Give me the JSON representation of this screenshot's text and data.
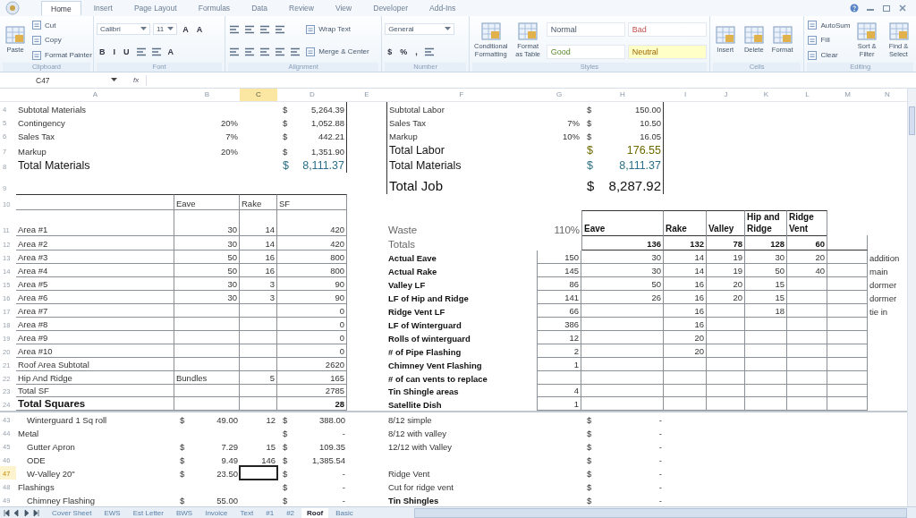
{
  "ribbon": {
    "tabs": [
      {
        "label": "Home",
        "selected": true
      },
      {
        "label": "Insert",
        "selected": false
      },
      {
        "label": "Page Layout",
        "selected": false
      },
      {
        "label": "Formulas",
        "selected": false
      },
      {
        "label": "Data",
        "selected": false
      },
      {
        "label": "Review",
        "selected": false
      },
      {
        "label": "View",
        "selected": false
      },
      {
        "label": "Developer",
        "selected": false
      },
      {
        "label": "Add-Ins",
        "selected": false
      }
    ],
    "groups": [
      {
        "label": "Clipboard",
        "columns": [
          [
            [
              {
                "kind": "large",
                "label": "Paste"
              }
            ]
          ],
          [
            [
              {
                "kind": "small",
                "label": "Cut"
              }
            ],
            [
              {
                "kind": "small",
                "label": "Copy"
              }
            ],
            [
              {
                "kind": "small",
                "label": "Format Painter"
              }
            ]
          ]
        ]
      },
      {
        "label": "Font",
        "columns": [
          [
            [
              {
                "kind": "field",
                "label": "Calibri"
              },
              {
                "kind": "field",
                "label": "11"
              },
              {
                "kind": "glyph",
                "label": "A"
              },
              {
                "kind": "glyph",
                "label": "A"
              }
            ],
            [
              {
                "kind": "glyph",
                "label": "B"
              },
              {
                "kind": "glyph",
                "label": "I"
              },
              {
                "kind": "glyph",
                "label": "U"
              },
              {
                "kind": "icon"
              },
              {
                "kind": "icon"
              },
              {
                "kind": "glyph",
                "label": "A"
              }
            ]
          ]
        ]
      },
      {
        "label": "Alignment",
        "columns": [
          [
            [
              {
                "kind": "icon"
              },
              {
                "kind": "icon"
              },
              {
                "kind": "icon"
              },
              {
                "kind": "icon"
              }
            ],
            [
              {
                "kind": "icon"
              },
              {
                "kind": "icon"
              },
              {
                "kind": "icon"
              },
              {
                "kind": "icon"
              },
              {
                "kind": "icon"
              }
            ]
          ],
          [
            [
              {
                "kind": "small",
                "label": "Wrap Text"
              }
            ],
            [
              {
                "kind": "small",
                "label": "Merge & Center"
              }
            ]
          ]
        ]
      },
      {
        "label": "Number",
        "columns": [
          [
            [
              {
                "kind": "field",
                "label": "General"
              }
            ],
            [
              {
                "kind": "glyph",
                "label": "$"
              },
              {
                "kind": "glyph",
                "label": "%"
              },
              {
                "kind": "glyph",
                "label": ","
              },
              {
                "kind": "icon"
              }
            ]
          ]
        ]
      },
      {
        "label": "Styles",
        "columns": [
          [
            [
              {
                "kind": "large",
                "label": "Conditional Formatting"
              }
            ]
          ],
          [
            [
              {
                "kind": "large",
                "label": "Format as Table"
              }
            ]
          ],
          [
            [
              {
                "kind": "style",
                "label": "Normal"
              },
              {
                "kind": "style",
                "label": "Bad"
              }
            ],
            [
              {
                "kind": "style",
                "label": "Good"
              },
              {
                "kind": "style",
                "label": "Neutral"
              }
            ]
          ]
        ]
      },
      {
        "label": "Cells",
        "columns": [
          [
            [
              {
                "kind": "large",
                "label": "Insert"
              }
            ]
          ],
          [
            [
              {
                "kind": "large",
                "label": "Delete"
              }
            ]
          ],
          [
            [
              {
                "kind": "large",
                "label": "Format"
              }
            ]
          ]
        ]
      },
      {
        "label": "Editing",
        "columns": [
          [
            [
              {
                "kind": "small",
                "label": "AutoSum"
              }
            ],
            [
              {
                "kind": "small",
                "label": "Fill"
              }
            ],
            [
              {
                "kind": "small",
                "label": "Clear"
              }
            ]
          ],
          [
            [
              {
                "kind": "large",
                "label": "Sort & Filter"
              }
            ]
          ],
          [
            [
              {
                "kind": "large",
                "label": "Find & Select"
              }
            ]
          ]
        ]
      }
    ]
  },
  "formula_bar": {
    "name_box": "C47",
    "function_label": "fx"
  },
  "sheet": {
    "columns": [
      {
        "label": "A",
        "selected": false
      },
      {
        "label": "B",
        "selected": false
      },
      {
        "label": "C",
        "selected": true
      },
      {
        "label": "D",
        "selected": false
      },
      {
        "label": "E",
        "selected": false
      },
      {
        "label": "F",
        "selected": false
      },
      {
        "label": "G",
        "selected": false
      },
      {
        "label": "H",
        "selected": false
      },
      {
        "label": "I",
        "selected": false
      },
      {
        "label": "J",
        "selected": false
      },
      {
        "label": "K",
        "selected": false
      },
      {
        "label": "L",
        "selected": false
      },
      {
        "label": "M",
        "selected": false
      },
      {
        "label": "N",
        "selected": false
      }
    ],
    "frozen_rows": [
      {
        "num": "4",
        "kind": "normal",
        "selected": false,
        "left_frame": true,
        "right_frame": true,
        "cells": [
          {
            "kind": "text",
            "text": "Subtotal Materials"
          },
          null,
          null,
          {
            "kind": "money",
            "cur": "$",
            "text": "5,264.39"
          },
          null,
          {
            "kind": "text",
            "text": "Subtotal Labor"
          },
          null,
          {
            "kind": "money",
            "cur": "$",
            "text": "150.00"
          },
          null,
          null,
          null,
          null,
          null,
          null
        ]
      },
      {
        "num": "5",
        "kind": "normal",
        "selected": false,
        "left_frame": true,
        "right_frame": true,
        "cells": [
          {
            "kind": "text",
            "text": "Contingency"
          },
          {
            "kind": "number",
            "text": "20%"
          },
          null,
          {
            "kind": "money",
            "cur": "$",
            "text": "1,052.88"
          },
          null,
          {
            "kind": "text",
            "text": "Sales Tax"
          },
          {
            "kind": "number",
            "text": "7%"
          },
          {
            "kind": "money",
            "cur": "$",
            "text": "10.50"
          },
          null,
          null,
          null,
          null,
          null,
          null
        ]
      },
      {
        "num": "6",
        "kind": "normal",
        "selected": false,
        "left_frame": true,
        "right_frame": true,
        "cells": [
          {
            "kind": "text",
            "text": "Sales Tax"
          },
          {
            "kind": "number",
            "text": "7%"
          },
          null,
          {
            "kind": "money",
            "cur": "$",
            "text": "442.21"
          },
          null,
          {
            "kind": "text",
            "text": "Markup"
          },
          {
            "kind": "number",
            "text": "10%"
          },
          {
            "kind": "money",
            "cur": "$",
            "text": "16.05"
          },
          null,
          null,
          null,
          null,
          null,
          null
        ]
      },
      {
        "num": "7",
        "kind": "tall",
        "selected": false,
        "left_frame": true,
        "right_frame": true,
        "cells": [
          {
            "kind": "text",
            "text": "Markup"
          },
          {
            "kind": "number",
            "text": "20%"
          },
          null,
          {
            "kind": "money",
            "cur": "$",
            "text": "1,351.90"
          },
          null,
          {
            "kind": "large",
            "text": "Total Labor"
          },
          null,
          {
            "kind": "labor",
            "cur": "$",
            "text": "176.55"
          },
          null,
          null,
          null,
          null,
          null,
          null
        ]
      },
      {
        "num": "8",
        "kind": "tall",
        "selected": false,
        "left_frame": true,
        "right_frame": true,
        "cells": [
          {
            "kind": "large",
            "text": "Total Materials"
          },
          null,
          null,
          {
            "kind": "sum",
            "cur": "$",
            "text": "8,111.37"
          },
          null,
          {
            "kind": "large",
            "text": "Total Materials"
          },
          null,
          {
            "kind": "sum",
            "cur": "$",
            "text": "8,111.37"
          },
          null,
          null,
          null,
          null,
          null,
          null
        ]
      },
      {
        "num": "9",
        "kind": "big",
        "selected": false,
        "right_frame": true,
        "cells": [
          null,
          null,
          null,
          null,
          null,
          {
            "kind": "title",
            "text": "Total Job"
          },
          null,
          {
            "kind": "grand",
            "cur": "$",
            "text": "8,287.92"
          },
          null,
          null,
          null,
          null,
          null,
          null
        ]
      },
      {
        "num": "10",
        "kind": "header",
        "selected": false,
        "left_grid": true,
        "cells": [
          null,
          {
            "kind": "text",
            "text": "Eave"
          },
          {
            "kind": "text",
            "text": "Rake"
          },
          {
            "kind": "text",
            "text": "SF"
          },
          null,
          null,
          null,
          null,
          null,
          null,
          null,
          null,
          null,
          null
        ]
      },
      {
        "num": "11",
        "kind": "double",
        "selected": false,
        "left_grid": true,
        "right_header": true,
        "cells": [
          {
            "kind": "text",
            "text": "Area #1"
          },
          {
            "kind": "number",
            "text": "30"
          },
          {
            "kind": "number",
            "text": "14"
          },
          {
            "kind": "number",
            "text": "420"
          },
          null,
          {
            "kind": "faint",
            "text": "Waste"
          },
          {
            "kind": "measure",
            "text": "110%"
          },
          {
            "kind": "heading",
            "text": "Eave"
          },
          {
            "kind": "heading",
            "text": "Rake"
          },
          {
            "kind": "heading",
            "text": "Valley"
          },
          {
            "kind": "heading",
            "text": "Hip and Ridge"
          },
          {
            "kind": "heading",
            "text": "Ridge Vent"
          },
          null,
          null
        ]
      },
      {
        "num": "12",
        "kind": "tall",
        "selected": false,
        "left_grid": true,
        "right_totals": true,
        "cells": [
          {
            "kind": "text",
            "text": "Area #2"
          },
          {
            "kind": "number",
            "text": "30"
          },
          {
            "kind": "number",
            "text": "14"
          },
          {
            "kind": "number",
            "text": "420"
          },
          null,
          {
            "kind": "faint",
            "text": "Totals"
          },
          null,
          {
            "kind": "figure",
            "text": "136"
          },
          {
            "kind": "figure",
            "text": "132"
          },
          {
            "kind": "figure",
            "text": "78"
          },
          {
            "kind": "figure",
            "text": "128"
          },
          {
            "kind": "figure",
            "text": "60"
          },
          null,
          null
        ]
      },
      {
        "num": "13",
        "kind": "normal",
        "selected": false,
        "left_grid": true,
        "right_grid": true,
        "cells": [
          {
            "kind": "text",
            "text": "Area #3"
          },
          {
            "kind": "number",
            "text": "50"
          },
          {
            "kind": "number",
            "text": "16"
          },
          {
            "kind": "number",
            "text": "800"
          },
          null,
          {
            "kind": "strong",
            "text": "Actual Eave"
          },
          {
            "kind": "number",
            "text": "150"
          },
          {
            "kind": "number",
            "text": "30"
          },
          {
            "kind": "number",
            "text": "14"
          },
          {
            "kind": "number",
            "text": "19"
          },
          {
            "kind": "number",
            "text": "30"
          },
          {
            "kind": "number",
            "text": "20"
          },
          null,
          {
            "kind": "text",
            "text": "addition"
          }
        ]
      },
      {
        "num": "14",
        "kind": "normal",
        "selected": false,
        "left_grid": true,
        "right_grid": true,
        "cells": [
          {
            "kind": "text",
            "text": "Area #4"
          },
          {
            "kind": "number",
            "text": "50"
          },
          {
            "kind": "number",
            "text": "16"
          },
          {
            "kind": "number",
            "text": "800"
          },
          null,
          {
            "kind": "strong",
            "text": "Actual Rake"
          },
          {
            "kind": "number",
            "text": "145"
          },
          {
            "kind": "number",
            "text": "30"
          },
          {
            "kind": "number",
            "text": "14"
          },
          {
            "kind": "number",
            "text": "19"
          },
          {
            "kind": "number",
            "text": "50"
          },
          {
            "kind": "number",
            "text": "40"
          },
          null,
          {
            "kind": "text",
            "text": "main"
          }
        ]
      },
      {
        "num": "15",
        "kind": "normal",
        "selected": false,
        "left_grid": true,
        "right_grid": true,
        "cells": [
          {
            "kind": "text",
            "text": "Area #5"
          },
          {
            "kind": "number",
            "text": "30"
          },
          {
            "kind": "number",
            "text": "3"
          },
          {
            "kind": "number",
            "text": "90"
          },
          null,
          {
            "kind": "strong",
            "text": "Valley LF"
          },
          {
            "kind": "number",
            "text": "86"
          },
          {
            "kind": "number",
            "text": "50"
          },
          {
            "kind": "number",
            "text": "16"
          },
          {
            "kind": "number",
            "text": "20"
          },
          {
            "kind": "number",
            "text": "15"
          },
          null,
          null,
          {
            "kind": "text",
            "text": "dormer"
          }
        ]
      },
      {
        "num": "16",
        "kind": "normal",
        "selected": false,
        "left_grid": true,
        "right_grid": true,
        "cells": [
          {
            "kind": "text",
            "text": "Area #6"
          },
          {
            "kind": "number",
            "text": "30"
          },
          {
            "kind": "number",
            "text": "3"
          },
          {
            "kind": "number",
            "text": "90"
          },
          null,
          {
            "kind": "strong",
            "text": "LF of Hip and Ridge"
          },
          {
            "kind": "number",
            "text": "141"
          },
          {
            "kind": "number",
            "text": "26"
          },
          {
            "kind": "number",
            "text": "16"
          },
          {
            "kind": "number",
            "text": "20"
          },
          {
            "kind": "number",
            "text": "15"
          },
          null,
          null,
          {
            "kind": "text",
            "text": "dormer"
          }
        ]
      },
      {
        "num": "17",
        "kind": "normal",
        "selected": false,
        "left_grid": true,
        "right_grid": true,
        "cells": [
          {
            "kind": "text",
            "text": "Area #7"
          },
          null,
          null,
          {
            "kind": "number",
            "text": "0"
          },
          null,
          {
            "kind": "strong",
            "text": "Ridge Vent LF"
          },
          {
            "kind": "number",
            "text": "66"
          },
          null,
          {
            "kind": "number",
            "text": "16"
          },
          null,
          {
            "kind": "number",
            "text": "18"
          },
          null,
          null,
          {
            "kind": "text",
            "text": "tie in"
          }
        ]
      },
      {
        "num": "18",
        "kind": "normal",
        "selected": false,
        "left_grid": true,
        "right_grid": true,
        "cells": [
          {
            "kind": "text",
            "text": "Area #8"
          },
          null,
          null,
          {
            "kind": "number",
            "text": "0"
          },
          null,
          {
            "kind": "strong",
            "text": "LF of Winterguard"
          },
          {
            "kind": "number",
            "text": "386"
          },
          null,
          {
            "kind": "number",
            "text": "16"
          },
          null,
          null,
          null,
          null,
          null
        ]
      },
      {
        "num": "19",
        "kind": "normal",
        "selected": false,
        "left_grid": true,
        "right_grid": true,
        "cells": [
          {
            "kind": "text",
            "text": "Area #9"
          },
          null,
          null,
          {
            "kind": "number",
            "text": "0"
          },
          null,
          {
            "kind": "strong",
            "text": "Rolls of winterguard"
          },
          {
            "kind": "number",
            "text": "12"
          },
          null,
          {
            "kind": "number",
            "text": "20"
          },
          null,
          null,
          null,
          null,
          null
        ]
      },
      {
        "num": "20",
        "kind": "normal",
        "selected": false,
        "left_grid": true,
        "right_grid": true,
        "cells": [
          {
            "kind": "text",
            "text": "Area #10"
          },
          null,
          null,
          {
            "kind": "number",
            "text": "0"
          },
          null,
          {
            "kind": "strong",
            "text": "# of Pipe Flashing"
          },
          {
            "kind": "number",
            "text": "2"
          },
          null,
          {
            "kind": "number",
            "text": "20"
          },
          null,
          null,
          null,
          null,
          null
        ]
      },
      {
        "num": "21",
        "kind": "normal",
        "selected": false,
        "left_grid": true,
        "right_grid": true,
        "cells": [
          {
            "kind": "text",
            "text": "Roof Area Subtotal"
          },
          null,
          null,
          {
            "kind": "number",
            "text": "2620"
          },
          null,
          {
            "kind": "strong",
            "text": "Chimney Vent Flashing"
          },
          {
            "kind": "number",
            "text": "1"
          },
          null,
          null,
          null,
          null,
          null,
          null,
          null
        ]
      },
      {
        "num": "22",
        "kind": "normal",
        "selected": false,
        "left_grid": true,
        "right_grid": true,
        "cells": [
          {
            "kind": "text",
            "text": "Hip And Ridge"
          },
          {
            "kind": "text",
            "text": "Bundles"
          },
          {
            "kind": "number",
            "text": "5"
          },
          {
            "kind": "number",
            "text": "165"
          },
          null,
          {
            "kind": "strong",
            "text": "# of can vents to replace"
          },
          null,
          null,
          null,
          null,
          null,
          null,
          null,
          null
        ]
      },
      {
        "num": "23",
        "kind": "normal",
        "selected": false,
        "left_grid": true,
        "right_grid": true,
        "cells": [
          {
            "kind": "text",
            "text": "Total SF"
          },
          null,
          null,
          {
            "kind": "number",
            "text": "2785"
          },
          null,
          {
            "kind": "strong",
            "text": "Tin Shingle areas"
          },
          {
            "kind": "number",
            "text": "4"
          },
          null,
          null,
          null,
          null,
          null,
          null,
          null
        ]
      },
      {
        "num": "24",
        "kind": "normal",
        "selected": false,
        "left_grid": true,
        "right_grid": true,
        "cells": [
          {
            "kind": "banner",
            "text": "Total Squares"
          },
          null,
          null,
          {
            "kind": "figure",
            "text": "28"
          },
          null,
          {
            "kind": "strong",
            "text": "Satellite Dish"
          },
          {
            "kind": "number",
            "text": "1"
          },
          null,
          null,
          null,
          null,
          null,
          null,
          null
        ]
      }
    ],
    "rows": [
      {
        "num": "43",
        "kind": "normal",
        "selected": false,
        "cells": [
          {
            "kind": "item",
            "text": "Winterguard 1 Sq roll"
          },
          {
            "kind": "money",
            "cur": "$",
            "text": "49.00"
          },
          {
            "kind": "number",
            "text": "12"
          },
          {
            "kind": "money",
            "cur": "$",
            "text": "388.00"
          },
          null,
          {
            "kind": "text",
            "text": "8/12 simple"
          },
          null,
          {
            "kind": "money",
            "cur": "$",
            "text": "-"
          },
          null,
          null,
          null,
          null,
          null,
          null
        ]
      },
      {
        "num": "44",
        "kind": "normal",
        "selected": false,
        "cells": [
          {
            "kind": "text",
            "text": "Metal"
          },
          null,
          null,
          {
            "kind": "money",
            "cur": "$",
            "text": "-"
          },
          null,
          {
            "kind": "text",
            "text": "8/12 with valley"
          },
          null,
          {
            "kind": "money",
            "cur": "$",
            "text": "-"
          },
          null,
          null,
          null,
          null,
          null,
          null
        ]
      },
      {
        "num": "45",
        "kind": "normal",
        "selected": false,
        "cells": [
          {
            "kind": "item",
            "text": "Gutter Apron"
          },
          {
            "kind": "money",
            "cur": "$",
            "text": "7.29"
          },
          {
            "kind": "number",
            "text": "15"
          },
          {
            "kind": "money",
            "cur": "$",
            "text": "109.35"
          },
          null,
          {
            "kind": "text",
            "text": "12/12 with Valley"
          },
          null,
          {
            "kind": "money",
            "cur": "$",
            "text": "-"
          },
          null,
          null,
          null,
          null,
          null,
          null
        ]
      },
      {
        "num": "46",
        "kind": "normal",
        "selected": false,
        "cells": [
          {
            "kind": "item",
            "text": "ODE"
          },
          {
            "kind": "money",
            "cur": "$",
            "text": "9.49"
          },
          {
            "kind": "number",
            "text": "146"
          },
          {
            "kind": "money",
            "cur": "$",
            "text": "1,385.54"
          },
          null,
          null,
          null,
          {
            "kind": "money",
            "cur": "$",
            "text": "-"
          },
          null,
          null,
          null,
          null,
          null,
          null
        ]
      },
      {
        "num": "47",
        "kind": "normal",
        "selected": true,
        "cells": [
          {
            "kind": "item",
            "text": "W-Valley 20\""
          },
          {
            "kind": "money",
            "cur": "$",
            "text": "23.50"
          },
          null,
          {
            "kind": "money",
            "cur": "$",
            "text": "-"
          },
          null,
          {
            "kind": "text",
            "text": "Ridge Vent"
          },
          null,
          {
            "kind": "money",
            "cur": "$",
            "text": "-"
          },
          null,
          null,
          null,
          null,
          null,
          null
        ]
      },
      {
        "num": "48",
        "kind": "normal",
        "selected": false,
        "cells": [
          {
            "kind": "text",
            "text": "Flashings"
          },
          null,
          null,
          {
            "kind": "money",
            "cur": "$",
            "text": "-"
          },
          null,
          {
            "kind": "text",
            "text": "Cut for ridge vent"
          },
          null,
          {
            "kind": "money",
            "cur": "$",
            "text": "-"
          },
          null,
          null,
          null,
          null,
          null,
          null
        ]
      },
      {
        "num": "49",
        "kind": "normal",
        "selected": false,
        "cells": [
          {
            "kind": "item",
            "text": "Chimney Flashing"
          },
          {
            "kind": "money",
            "cur": "$",
            "text": "55.00"
          },
          null,
          {
            "kind": "money",
            "cur": "$",
            "text": "-"
          },
          null,
          {
            "kind": "strong",
            "text": "Tin Shingles"
          },
          null,
          {
            "kind": "money",
            "cur": "$",
            "text": "-"
          },
          null,
          null,
          null,
          null,
          null,
          null
        ]
      }
    ]
  },
  "sheet_tabs": [
    {
      "label": "Cover Sheet",
      "selected": false
    },
    {
      "label": "EWS",
      "selected": false
    },
    {
      "label": "Est Letter",
      "selected": false
    },
    {
      "label": "BWS",
      "selected": false
    },
    {
      "label": "Invoice",
      "selected": false
    },
    {
      "label": "Text",
      "selected": false
    },
    {
      "label": "#1",
      "selected": false
    },
    {
      "label": "#2",
      "selected": false
    },
    {
      "label": "Roof",
      "selected": true
    },
    {
      "label": "Basic",
      "selected": false
    }
  ]
}
